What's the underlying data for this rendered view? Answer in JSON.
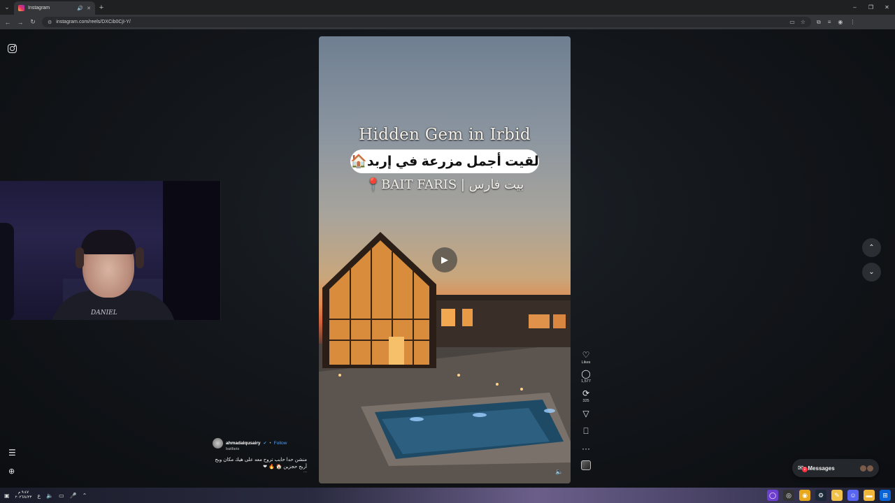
{
  "browser": {
    "tab_title": "Instagram",
    "new_tab": "+",
    "url": "instagram.com/reels/DXCib0CjI-Y/",
    "window_controls": [
      "–",
      "❐",
      "✕"
    ]
  },
  "sidebar": {
    "logo_icon": "instagram-logo-icon",
    "menu_icon": "☰",
    "apps_icon": "⊕"
  },
  "webcam": {
    "shirt_text": "DANIEL"
  },
  "reel": {
    "title_en": "Hidden Gem in Irbid",
    "title_pill": "لقيت أجمل مزرعة في إربد🏠",
    "title_ar": "📍BAIT FARIS | بيت فارس",
    "play_icon": "▶",
    "mute_icon": "🔈"
  },
  "actions": {
    "likes_label": "Likes",
    "comments_count": "1,577",
    "shares_count": "325",
    "more_icon": "···"
  },
  "caption": {
    "username": "ahmadalqusairy",
    "verified": "✔",
    "dot": "•",
    "follow": "Follow",
    "collab": "baitfaris",
    "text": "منشن حدا حابب تروح معه على هيك مكان وبح أربح حجزين 🏠 🔥 ❤",
    "more": "..."
  },
  "nav": {
    "up_icon": "⌃",
    "down_icon": "⌄"
  },
  "messages": {
    "label": "Messages",
    "badge": "2"
  },
  "taskbar": {
    "time": "٩:٤٧ م",
    "date": "٢٠٢٦/٤/٢٣",
    "lang": "ع"
  },
  "colors": {
    "accent_blue": "#4b9ff5",
    "badge_red": "#ff3040"
  }
}
